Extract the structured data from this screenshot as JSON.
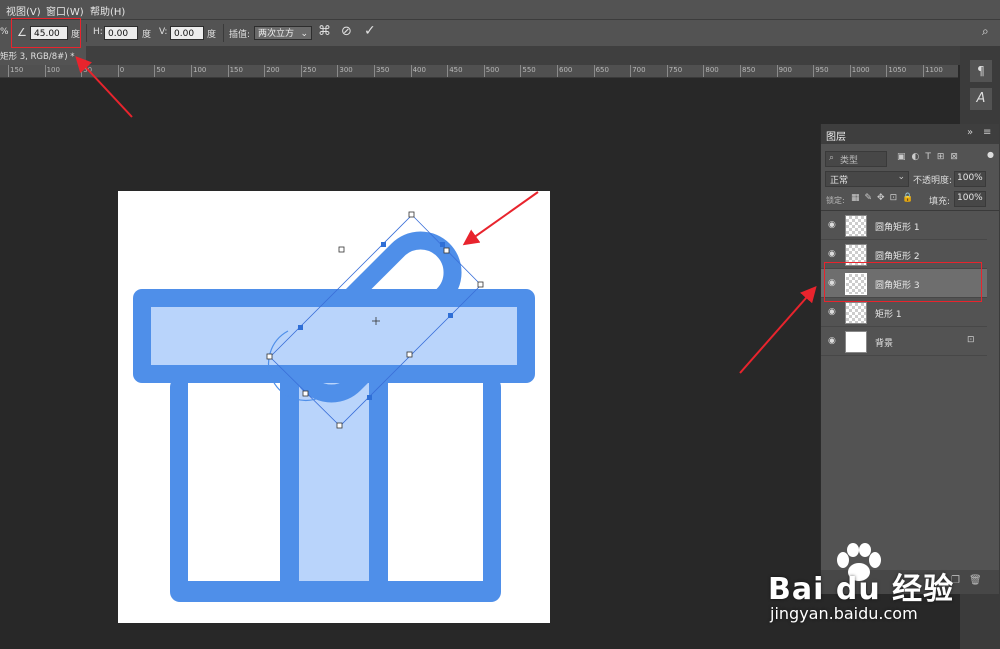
{
  "menu": [
    "视图(V)",
    "窗口(W)",
    "帮助(H)"
  ],
  "options": {
    "percent_suffix": "%",
    "angle_value": "45.00",
    "angle_unit": "度",
    "h_label": "H:",
    "h_value": "0.00",
    "h_unit": "度",
    "v_label": "V:",
    "v_value": "0.00",
    "v_unit": "度",
    "interp_label": "插值:",
    "interp_value": "两次立方"
  },
  "doc_tab": "矩形 3, RGB/8#) *",
  "ruler_ticks": [
    "150",
    "100",
    "50",
    "0",
    "50",
    "100",
    "150",
    "200",
    "250",
    "300",
    "350",
    "400",
    "450",
    "500",
    "550",
    "600",
    "650",
    "700",
    "750",
    "800",
    "850",
    "900",
    "950",
    "1000",
    "1050",
    "1100"
  ],
  "layers_panel": {
    "title": "图层",
    "kind_placeholder": "类型",
    "blend_mode": "正常",
    "opacity_label": "不透明度:",
    "opacity_value": "100%",
    "lock_label": "锁定:",
    "fill_label": "填充:",
    "fill_value": "100%",
    "layers": [
      {
        "name": "圆角矩形 1",
        "selected": false
      },
      {
        "name": "圆角矩形 2",
        "selected": false
      },
      {
        "name": "圆角矩形 3",
        "selected": true
      },
      {
        "name": "矩形 1",
        "selected": false
      },
      {
        "name": "背景",
        "selected": false
      }
    ]
  },
  "watermark": {
    "brand": "Bai du 经验",
    "url": "jingyan.baidu.com"
  },
  "colors": {
    "accent_blue": "#4f8fe9",
    "light_blue": "#b9d4fb",
    "annotation_red": "#e8242d",
    "panel_bg": "#535353"
  }
}
